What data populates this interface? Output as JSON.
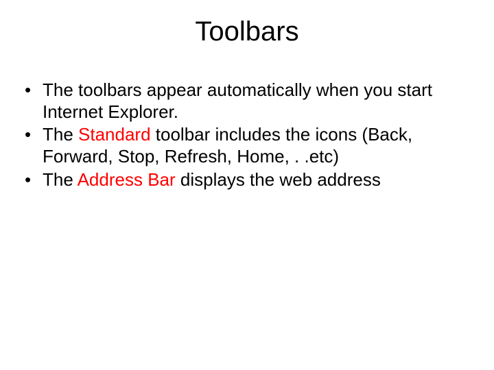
{
  "title": "Toolbars",
  "bullets": {
    "b0": {
      "dot": "•",
      "t0": "The toolbars appear automatically when you start Internet Explorer."
    },
    "b1": {
      "dot": "•",
      "t0": "The ",
      "accent": "Standard",
      "t1": " toolbar includes the icons (Back, Forward, Stop, Refresh, Home, . .etc)"
    },
    "b2": {
      "dot": "•",
      "t0": "The ",
      "accent": "Address Bar",
      "t1": " displays the web address"
    }
  }
}
